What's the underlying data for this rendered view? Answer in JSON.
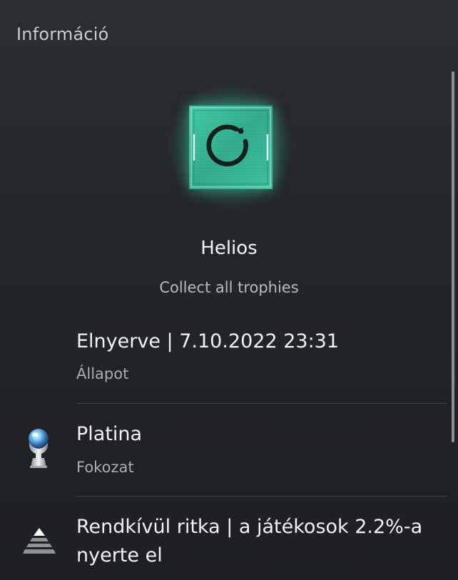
{
  "panel": {
    "title": "Információ"
  },
  "trophy": {
    "name": "Helios",
    "description": "Collect all trophies",
    "icon": "ouroboros-trophy-icon",
    "glow_color": "#3fc9a3"
  },
  "status": {
    "value": "Elnyerve | 7.10.2022  23:31",
    "label": "Állapot"
  },
  "grade": {
    "value": "Platina",
    "label": "Fokozat",
    "icon": "platinum-trophy-icon"
  },
  "rarity": {
    "value_line1": "Rendkívül ritka | a játékosok 2.2%-a",
    "value_line2": "nyerte el",
    "icon": "rarity-pyramid-icon"
  }
}
